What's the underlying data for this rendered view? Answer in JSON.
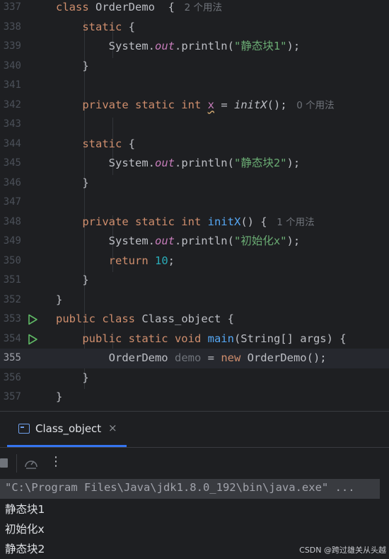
{
  "editor": {
    "lines": [
      {
        "n": "337",
        "parts": [
          {
            "t": "class ",
            "c": "kw"
          },
          {
            "t": "OrderDemo  { ",
            "c": "cls"
          },
          {
            "t": " 2 个用法",
            "c": "hint"
          }
        ]
      },
      {
        "n": "338",
        "parts": [
          {
            "t": "    static ",
            "c": "kw"
          },
          {
            "t": "{",
            "c": "cls"
          }
        ]
      },
      {
        "n": "339",
        "parts": [
          {
            "t": "        System.",
            "c": "cls"
          },
          {
            "t": "out",
            "c": "field"
          },
          {
            "t": ".println(",
            "c": "cls"
          },
          {
            "t": "\"静态块1\"",
            "c": "str"
          },
          {
            "t": ");",
            "c": "cls"
          }
        ]
      },
      {
        "n": "340",
        "parts": [
          {
            "t": "    }",
            "c": "cls"
          }
        ]
      },
      {
        "n": "341",
        "parts": []
      },
      {
        "n": "342",
        "parts": [
          {
            "t": "    private static int ",
            "c": "kw"
          },
          {
            "t": "x",
            "c": "warnvar"
          },
          {
            "t": " = ",
            "c": "cls"
          },
          {
            "t": "initX",
            "c": "cls ital"
          },
          {
            "t": "(); ",
            "c": "cls"
          },
          {
            "t": " 0 个用法",
            "c": "hint"
          }
        ]
      },
      {
        "n": "343",
        "parts": []
      },
      {
        "n": "344",
        "parts": [
          {
            "t": "    static ",
            "c": "kw"
          },
          {
            "t": "{",
            "c": "cls"
          }
        ]
      },
      {
        "n": "345",
        "parts": [
          {
            "t": "        System.",
            "c": "cls"
          },
          {
            "t": "out",
            "c": "field"
          },
          {
            "t": ".println(",
            "c": "cls"
          },
          {
            "t": "\"静态块2\"",
            "c": "str"
          },
          {
            "t": ");",
            "c": "cls"
          }
        ]
      },
      {
        "n": "346",
        "parts": [
          {
            "t": "    }",
            "c": "cls"
          }
        ]
      },
      {
        "n": "347",
        "parts": []
      },
      {
        "n": "348",
        "parts": [
          {
            "t": "    private static int ",
            "c": "kw"
          },
          {
            "t": "initX",
            "c": "fn"
          },
          {
            "t": "() { ",
            "c": "cls"
          },
          {
            "t": " 1 个用法",
            "c": "hint"
          }
        ]
      },
      {
        "n": "349",
        "parts": [
          {
            "t": "        System.",
            "c": "cls"
          },
          {
            "t": "out",
            "c": "field"
          },
          {
            "t": ".println(",
            "c": "cls"
          },
          {
            "t": "\"初始化x\"",
            "c": "str"
          },
          {
            "t": ");",
            "c": "cls"
          }
        ]
      },
      {
        "n": "350",
        "parts": [
          {
            "t": "        return ",
            "c": "kw"
          },
          {
            "t": "10",
            "c": "num"
          },
          {
            "t": ";",
            "c": "cls"
          }
        ]
      },
      {
        "n": "351",
        "parts": [
          {
            "t": "    }",
            "c": "cls"
          }
        ]
      },
      {
        "n": "352",
        "parts": [
          {
            "t": "}",
            "c": "cls"
          }
        ]
      },
      {
        "n": "353",
        "run": true,
        "parts": [
          {
            "t": "public class ",
            "c": "kw"
          },
          {
            "t": "Class_object {",
            "c": "cls"
          }
        ]
      },
      {
        "n": "354",
        "run": true,
        "parts": [
          {
            "t": "    public static void ",
            "c": "kw"
          },
          {
            "t": "main",
            "c": "fn"
          },
          {
            "t": "(String[] args) {",
            "c": "cls"
          }
        ]
      },
      {
        "n": "355",
        "current": true,
        "parts": [
          {
            "t": "        OrderDemo ",
            "c": "cls"
          },
          {
            "t": "demo",
            "c": "grey"
          },
          {
            "t": " = ",
            "c": "cls"
          },
          {
            "t": "new ",
            "c": "kw"
          },
          {
            "t": "OrderDemo();",
            "c": "cls"
          }
        ]
      },
      {
        "n": "356",
        "parts": [
          {
            "t": "    }",
            "c": "cls"
          }
        ]
      },
      {
        "n": "357",
        "parts": [
          {
            "t": "}",
            "c": "cls"
          }
        ]
      }
    ]
  },
  "run_panel": {
    "tab_label": "Class_object",
    "tab_close": "×",
    "more_label": "⋮",
    "command": "\"C:\\Program Files\\Java\\jdk1.8.0_192\\bin\\java.exe\" ...",
    "output": [
      "静态块1",
      "初始化x",
      "静态块2"
    ]
  },
  "watermark": "CSDN @跨过雄关从头越",
  "colors": {
    "accent": "#3574f0",
    "run": "#5fb865",
    "background": "#1e1f22"
  }
}
